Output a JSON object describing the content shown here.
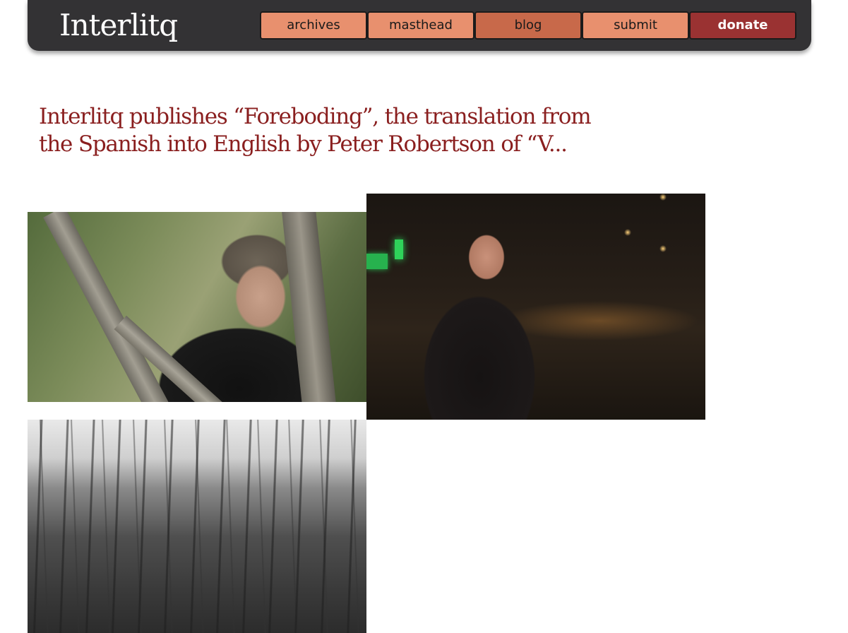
{
  "site": {
    "logo": "Interlitq"
  },
  "nav": {
    "archives": "archives",
    "masthead": "masthead",
    "blog": "blog",
    "submit": "submit",
    "donate": "donate"
  },
  "article": {
    "headline": "Interlitq publishes “Foreboding”, the translation from the Spanish into English by Peter Robertson of “V..."
  },
  "colors": {
    "header_bg": "#333234",
    "nav_light": "#e8906e",
    "nav_active": "#c8694a",
    "donate": "#9a3232",
    "headline": "#8a1f1f"
  }
}
